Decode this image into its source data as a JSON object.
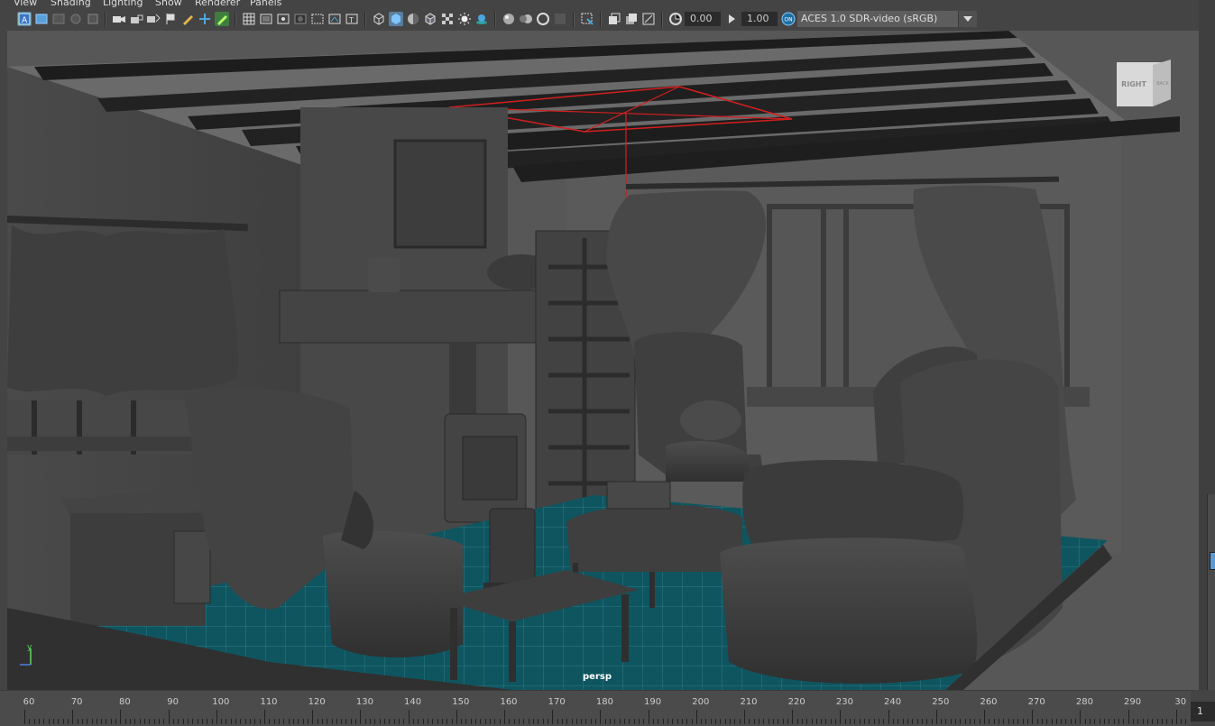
{
  "menu": {
    "items": [
      "View",
      "Shading",
      "Lighting",
      "Show",
      "Renderer",
      "Panels"
    ]
  },
  "toolbar": {
    "exposure": "0.00",
    "gamma": "1.00",
    "color_space_badge": "ON",
    "color_space": "ACES 1.0 SDR-video (sRGB)"
  },
  "viewport": {
    "camera": "persp",
    "axis_label": "y",
    "viewcube": {
      "right": "RIGHT",
      "back": "BACK"
    },
    "floor_color": "#0f5560",
    "light_color": "#d41f1f"
  },
  "timeline": {
    "ticks": [
      "60",
      "70",
      "80",
      "90",
      "100",
      "110",
      "120",
      "130",
      "140",
      "150",
      "160",
      "170",
      "180",
      "190",
      "200",
      "210",
      "220",
      "230",
      "240",
      "250",
      "260",
      "270",
      "280",
      "290",
      "30"
    ],
    "current_frame": "1"
  }
}
